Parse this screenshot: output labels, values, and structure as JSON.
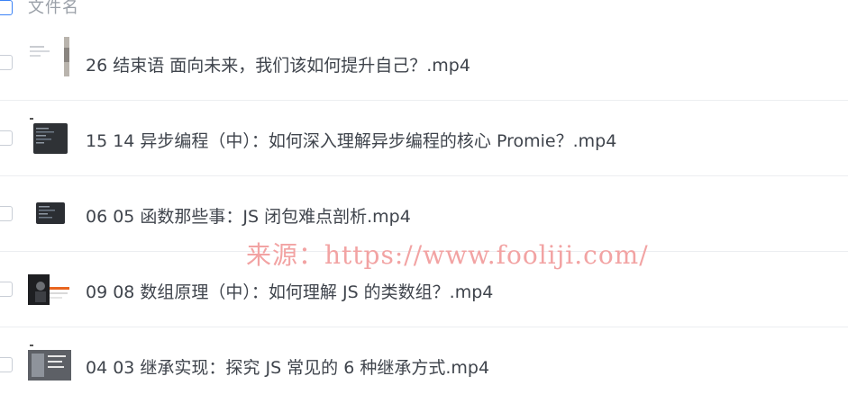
{
  "list": {
    "header_label": "文件名",
    "files": [
      {
        "name": "26 结束语 面向未来，我们该如何提升自己？.mp4",
        "thumb": "slide-thumbnail"
      },
      {
        "name": "15 14 异步编程（中）：如何深入理解异步编程的核心 Promie？.mp4",
        "thumb": "code-editor-thumbnail"
      },
      {
        "name": "06 05 函数那些事：JS 闭包难点剖析.mp4",
        "thumb": "code-editor-thumbnail"
      },
      {
        "name": "09 08 数组原理（中）：如何理解 JS 的类数组？.mp4",
        "thumb": "presenter-thumbnail"
      },
      {
        "name": "04 03 继承实现：探究 JS 常见的 6 种继承方式.mp4",
        "thumb": "slide-thumbnail"
      }
    ]
  },
  "watermark": "来源：https://www.fooliji.com/",
  "colors": {
    "checkbox_active": "#3b82f6",
    "row_divider": "#eceef1",
    "watermark": "#f2a3a3"
  }
}
